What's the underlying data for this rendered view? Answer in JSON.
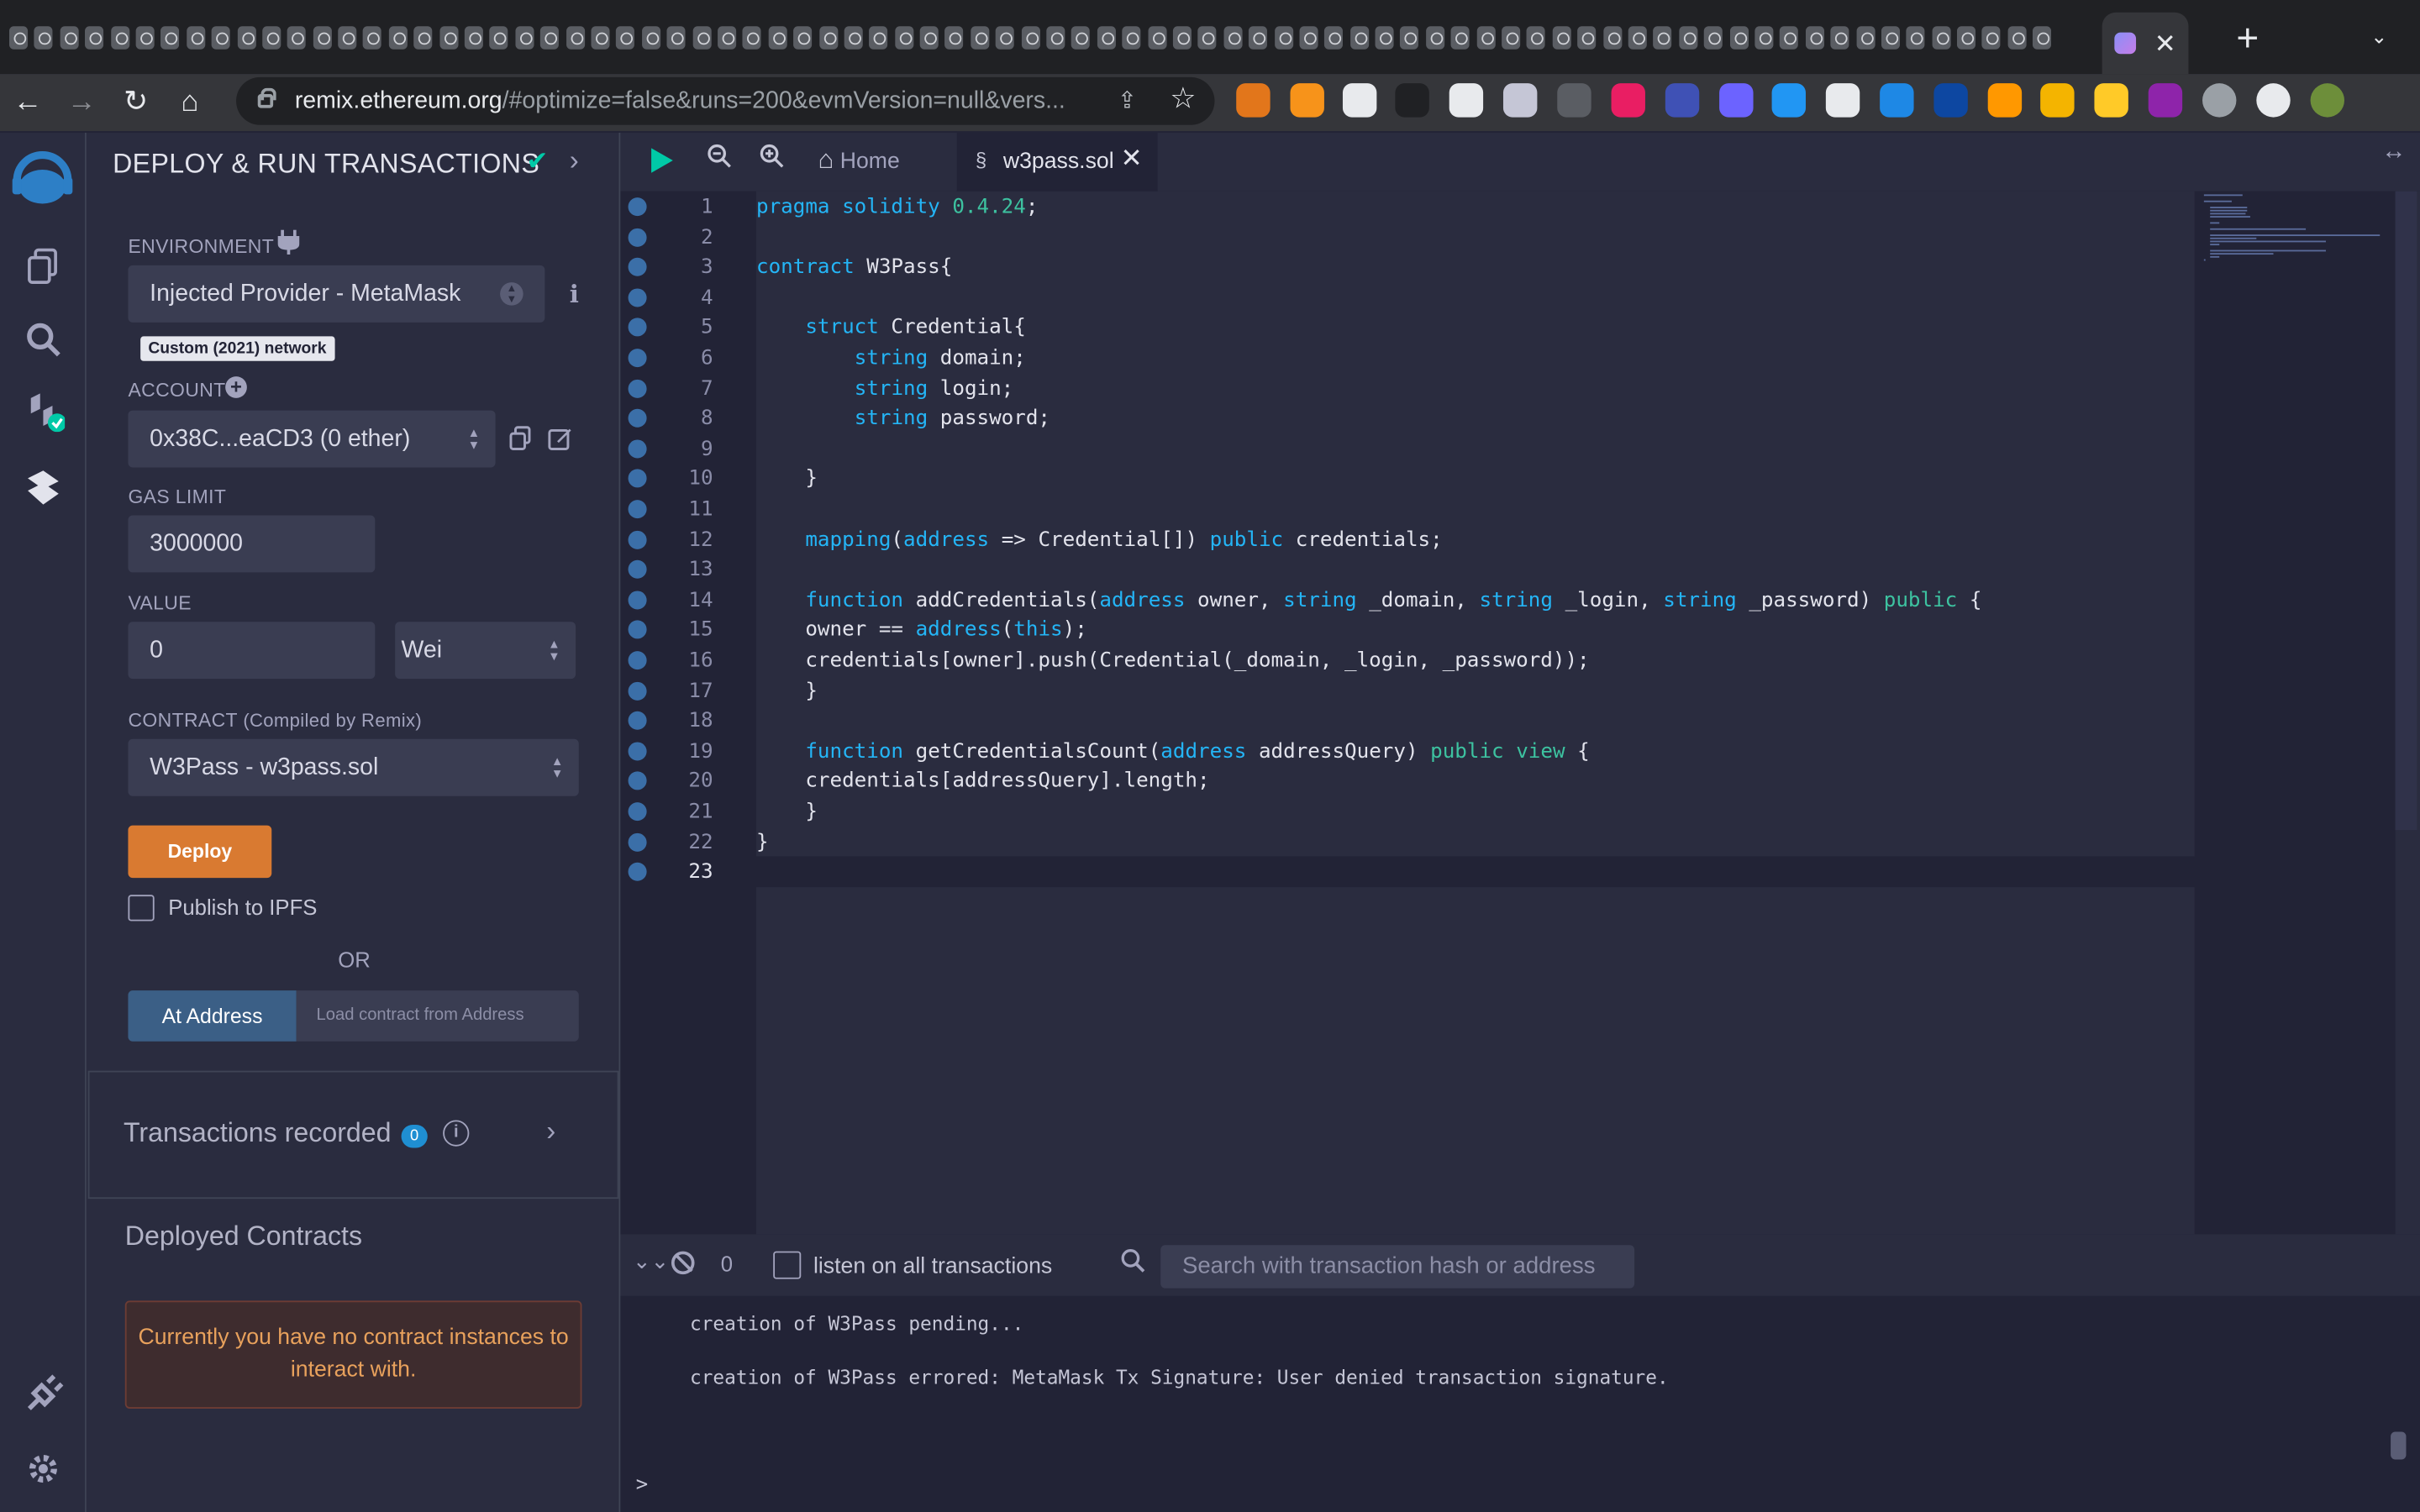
{
  "browser": {
    "url_host": "remix.ethereum.org",
    "url_path": "/#optimize=false&runs=200&evmVersion=null&vers...",
    "tab_close": "✕",
    "new_tab": "+"
  },
  "sidepanel": {
    "title": "DEPLOY & RUN TRANSACTIONS",
    "environment_label": "ENVIRONMENT",
    "environment_value": "Injected Provider - MetaMask",
    "network_badge": "Custom (2021) network",
    "account_label": "ACCOUNT",
    "account_value": "0x38C...eaCD3 (0 ether)",
    "gas_limit_label": "GAS LIMIT",
    "gas_limit_value": "3000000",
    "value_label": "VALUE",
    "value_amount": "0",
    "value_unit": "Wei",
    "contract_label": "CONTRACT",
    "contract_sub": "(Compiled by Remix)",
    "contract_value": "W3Pass - w3pass.sol",
    "deploy_button": "Deploy",
    "publish_ipfs": "Publish to IPFS",
    "or": "OR",
    "at_address_button": "At Address",
    "load_address_placeholder": "Load contract from Address",
    "transactions_recorded": "Transactions recorded",
    "transactions_count": "0",
    "deployed_contracts": "Deployed Contracts",
    "no_instances": "Currently you have no contract instances to interact with."
  },
  "editor": {
    "home_tab": "Home",
    "file_tab": "w3pass.sol",
    "current_line": 23,
    "lines": [
      [
        [
          "k",
          "pragma solidity "
        ],
        [
          "g",
          "0.4.24"
        ],
        [
          "n",
          ";"
        ]
      ],
      [],
      [
        [
          "k",
          "contract "
        ],
        [
          "n",
          "W3Pass{"
        ]
      ],
      [],
      [
        [
          "n",
          "    "
        ],
        [
          "k",
          "struct "
        ],
        [
          "n",
          "Credential{"
        ]
      ],
      [
        [
          "n",
          "        "
        ],
        [
          "k",
          "string "
        ],
        [
          "n",
          "domain;"
        ]
      ],
      [
        [
          "n",
          "        "
        ],
        [
          "k",
          "string "
        ],
        [
          "n",
          "login;"
        ]
      ],
      [
        [
          "n",
          "        "
        ],
        [
          "k",
          "string "
        ],
        [
          "n",
          "password;"
        ]
      ],
      [],
      [
        [
          "n",
          "    }"
        ]
      ],
      [],
      [
        [
          "n",
          "    "
        ],
        [
          "k",
          "mapping"
        ],
        [
          "n",
          "("
        ],
        [
          "k",
          "address"
        ],
        [
          "n",
          " => Credential[]) "
        ],
        [
          "k",
          "public"
        ],
        [
          "n",
          " credentials;"
        ]
      ],
      [],
      [
        [
          "n",
          "    "
        ],
        [
          "k",
          "function "
        ],
        [
          "n",
          "addCredentials("
        ],
        [
          "k",
          "address"
        ],
        [
          "n",
          " owner, "
        ],
        [
          "k",
          "string"
        ],
        [
          "n",
          " _domain, "
        ],
        [
          "k",
          "string"
        ],
        [
          "n",
          " _login, "
        ],
        [
          "k",
          "string"
        ],
        [
          "n",
          " _password) "
        ],
        [
          "g",
          "public"
        ],
        [
          "n",
          " {"
        ]
      ],
      [
        [
          "n",
          "    owner == "
        ],
        [
          "k",
          "address"
        ],
        [
          "n",
          "("
        ],
        [
          "k",
          "this"
        ],
        [
          "n",
          ");"
        ]
      ],
      [
        [
          "n",
          "    credentials[owner].push(Credential(_domain, _login, _password));"
        ]
      ],
      [
        [
          "n",
          "    }"
        ]
      ],
      [],
      [
        [
          "n",
          "    "
        ],
        [
          "k",
          "function "
        ],
        [
          "n",
          "getCredentialsCount("
        ],
        [
          "k",
          "address"
        ],
        [
          "n",
          " addressQuery) "
        ],
        [
          "g",
          "public"
        ],
        [
          "n",
          " "
        ],
        [
          "g",
          "view"
        ],
        [
          "n",
          " {"
        ]
      ],
      [
        [
          "n",
          "    credentials[addressQuery].length;"
        ]
      ],
      [
        [
          "n",
          "    }"
        ]
      ],
      [
        [
          "n",
          "}"
        ]
      ],
      []
    ]
  },
  "terminal": {
    "count": "0",
    "listen_label": "listen on all transactions",
    "search_placeholder": "Search with transaction hash or address",
    "lines": [
      "creation of W3Pass pending...",
      "creation of W3Pass errored: MetaMask Tx Signature: User denied transaction signature."
    ],
    "prompt": ">"
  },
  "colors": {
    "accent_deploy": "#d97a31",
    "success_check": "#00c9a7",
    "keyword": "#24b5f6",
    "keyword_green": "#3dc2a0"
  }
}
